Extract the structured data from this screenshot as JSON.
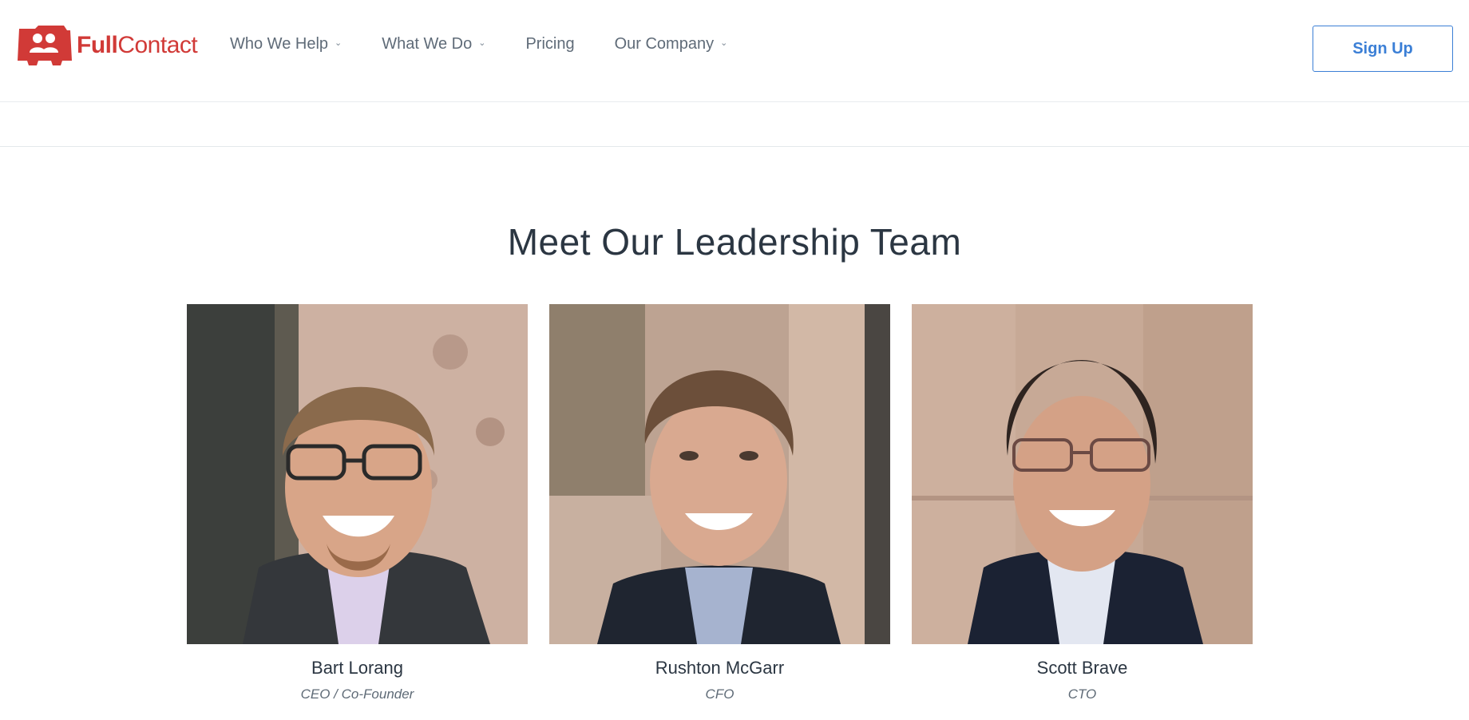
{
  "header": {
    "logo_text_bold": "Full",
    "logo_text_regular": "Contact",
    "nav": [
      {
        "label": "Who We Help",
        "has_dropdown": true
      },
      {
        "label": "What We Do",
        "has_dropdown": true
      },
      {
        "label": "Pricing",
        "has_dropdown": false
      },
      {
        "label": "Our Company",
        "has_dropdown": true
      }
    ],
    "signup_label": "Sign Up"
  },
  "main": {
    "heading": "Meet Our Leadership Team",
    "team": [
      {
        "name": "Bart Lorang",
        "role": "CEO / Co-Founder"
      },
      {
        "name": "Rushton McGarr",
        "role": "CFO"
      },
      {
        "name": "Scott Brave",
        "role": "CTO"
      }
    ]
  },
  "colors": {
    "brand": "#d13a37",
    "accent": "#3b7fd6",
    "nav_text": "#5f6b78",
    "heading_text": "#2b3642"
  }
}
